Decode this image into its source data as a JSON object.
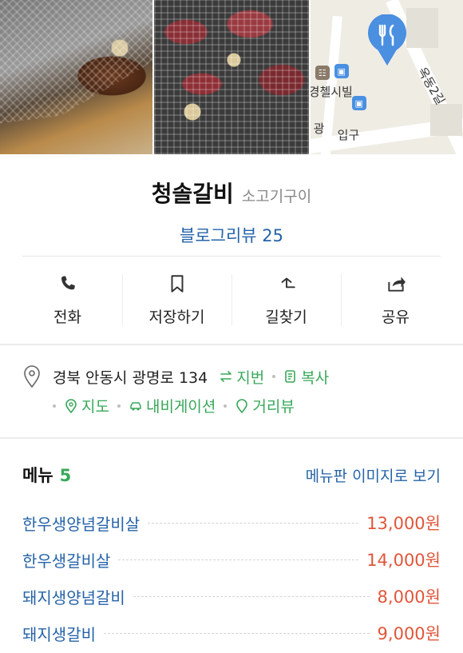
{
  "map": {
    "label_building": "경첼시빌",
    "label_road": "옥동2길",
    "label_side1": "입구",
    "label_side2": "광"
  },
  "place": {
    "name": "청솔갈비",
    "category": "소고기구이",
    "blog_review_label": "블로그리뷰 25"
  },
  "actions": [
    {
      "label": "전화",
      "icon": "phone-icon"
    },
    {
      "label": "저장하기",
      "icon": "bookmark-icon"
    },
    {
      "label": "길찾기",
      "icon": "directions-icon"
    },
    {
      "label": "공유",
      "icon": "share-icon"
    }
  ],
  "address": {
    "text": "경북 안동시 광명로 134",
    "lot_number_label": "지번",
    "copy_label": "복사",
    "map_label": "지도",
    "navigation_label": "내비게이션",
    "street_view_label": "거리뷰"
  },
  "menu": {
    "title": "메뉴",
    "count": "5",
    "board_link": "메뉴판 이미지로 보기",
    "items": [
      {
        "name": "한우생양념갈비살",
        "price": "13,000원"
      },
      {
        "name": "한우생갈비살",
        "price": "14,000원"
      },
      {
        "name": "돼지생양념갈비",
        "price": "8,000원"
      },
      {
        "name": "돼지생갈비",
        "price": "9,000원"
      }
    ]
  },
  "colors": {
    "link_blue": "#2563a8",
    "accent_green": "#38a85a",
    "price_red": "#e0563a",
    "map_pin": "#4a8fe0"
  }
}
